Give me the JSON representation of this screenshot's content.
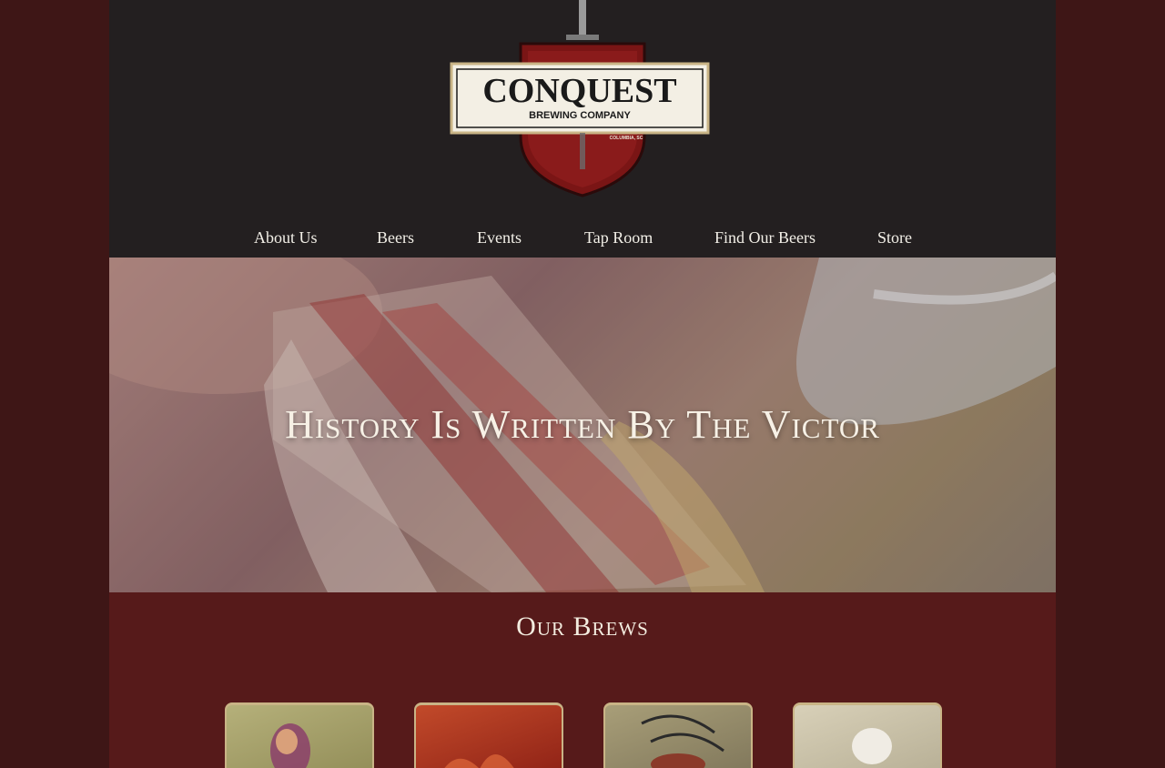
{
  "brand": {
    "name": "CONQUEST",
    "subtitle": "BREWING COMPANY",
    "location": "COLUMBIA, SC"
  },
  "nav": {
    "items": [
      {
        "label": "About Us"
      },
      {
        "label": "Beers"
      },
      {
        "label": "Events"
      },
      {
        "label": "Tap Room"
      },
      {
        "label": "Find Our Beers"
      },
      {
        "label": "Store"
      }
    ]
  },
  "hero": {
    "title": "History Is Written By The Victor"
  },
  "brews": {
    "title": "Our Brews"
  },
  "colors": {
    "outer_background": "#3e1616",
    "page_background": "#561a1a",
    "header_background": "#231f20",
    "nav_text": "#f2efe7",
    "card_border": "#c9b486"
  }
}
